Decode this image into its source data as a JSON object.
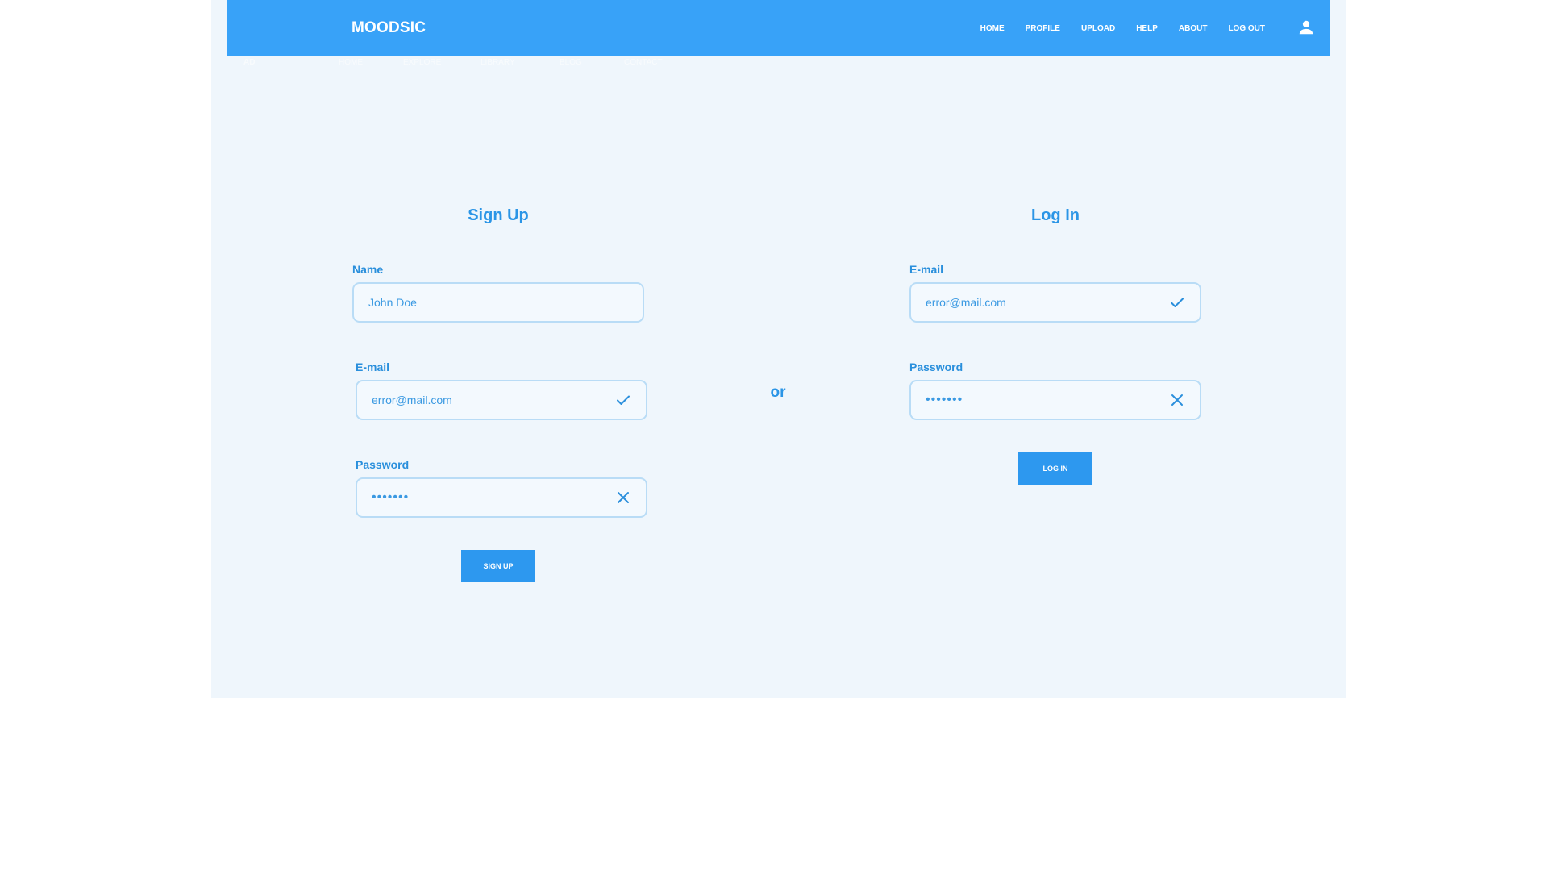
{
  "header": {
    "brand": "MOODSIC",
    "nav": [
      "HOME",
      "PROFILE",
      "UPLOAD",
      "HELP",
      "ABOUT",
      "LOG OUT"
    ]
  },
  "ghost_nav": {
    "logo": "AD",
    "items": [
      "HOME",
      "EXPLORE",
      "LIBRARY",
      "BLOG",
      "CONTACT"
    ]
  },
  "signup": {
    "title": "Sign Up",
    "name_label": "Name",
    "name_value": "John Doe",
    "email_label": "E-mail",
    "email_value": "error@mail.com",
    "password_label": "Password",
    "password_value": "•••••••",
    "submit_label": "SIGN UP"
  },
  "separator": "or",
  "login": {
    "title": "Log In",
    "email_label": "E-mail",
    "email_value": "error@mail.com",
    "password_label": "Password",
    "password_value": "•••••••",
    "submit_label": "LOG IN"
  },
  "colors": {
    "accent": "#38a2f8",
    "page_background": "#eff6fc",
    "field_border": "#b9dcf6",
    "text_blue": "#2b95e6"
  },
  "icons": {
    "user": "user-icon",
    "valid": "check-icon",
    "invalid": "close-icon"
  }
}
